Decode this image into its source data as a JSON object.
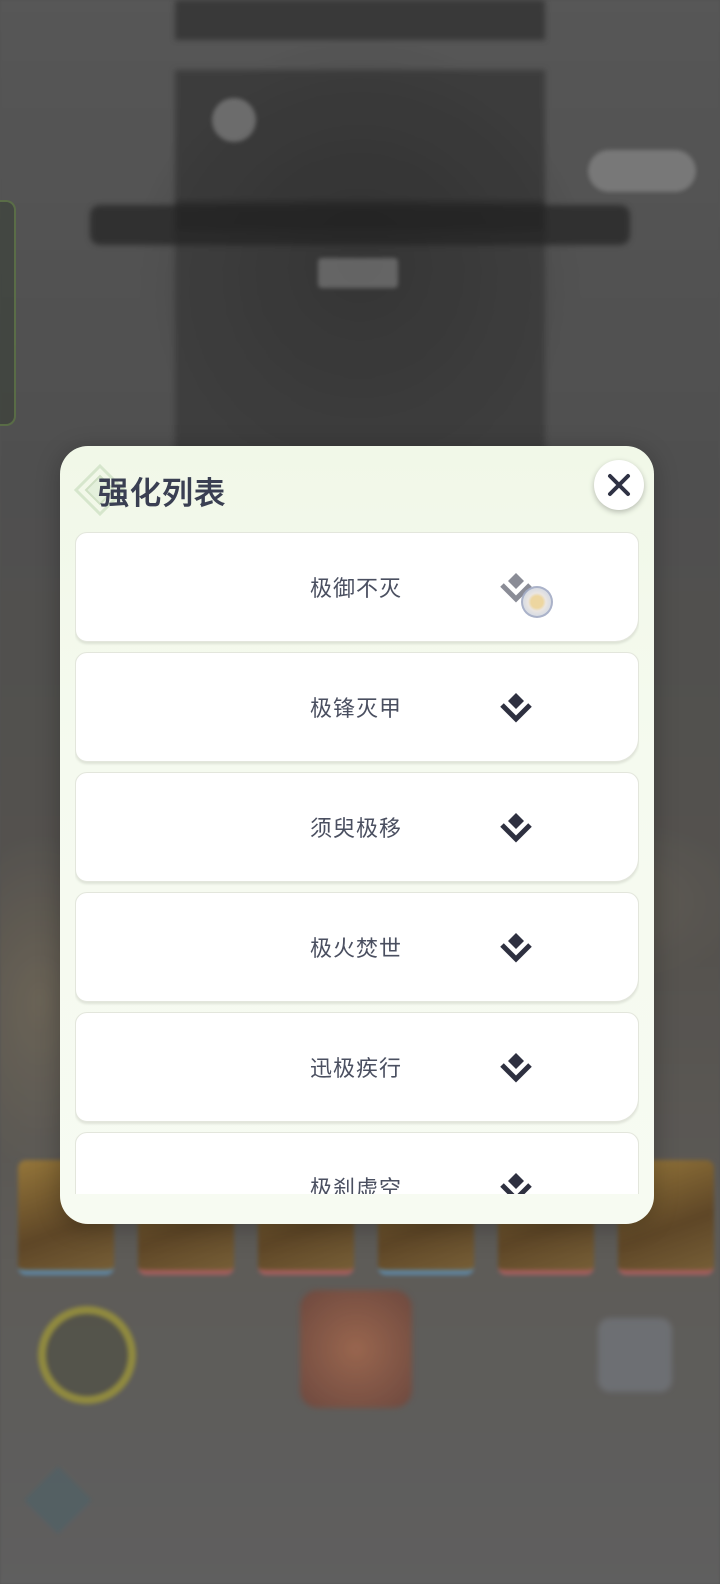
{
  "background": {
    "title": "",
    "cards": [
      {
        "accent": "#6aa0c8"
      },
      {
        "accent": "#c86a6a"
      },
      {
        "accent": "#c86a6a"
      },
      {
        "accent": "#6aa0c8"
      },
      {
        "accent": "#c86a6a"
      },
      {
        "accent": "#c86a6a"
      }
    ]
  },
  "modal": {
    "title": "强化列表",
    "close_icon": "close-x-icon",
    "item_icon": "double-chevron-upgrade-icon",
    "items": [
      {
        "label": "极御不灭",
        "state": "selected"
      },
      {
        "label": "极锋灭甲"
      },
      {
        "label": "须臾极移"
      },
      {
        "label": "极火焚世"
      },
      {
        "label": "迅极疾行"
      },
      {
        "label": "极刹虚空"
      }
    ]
  },
  "colors": {
    "modal_bg": "#f3f9ec",
    "text": "#4a4f60",
    "title": "#3a3f52",
    "icon": "#2e3040"
  }
}
